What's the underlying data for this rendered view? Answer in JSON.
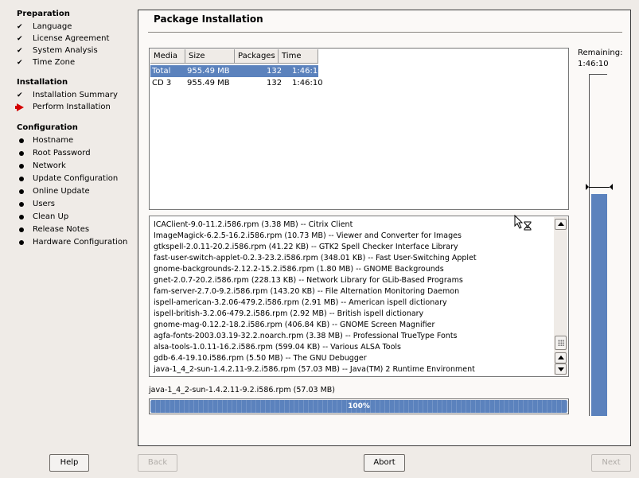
{
  "sidebar": {
    "sections": [
      {
        "title": "Preparation",
        "items": [
          {
            "label": "Language",
            "state": "done"
          },
          {
            "label": "License Agreement",
            "state": "done"
          },
          {
            "label": "System Analysis",
            "state": "done"
          },
          {
            "label": "Time Zone",
            "state": "done"
          }
        ]
      },
      {
        "title": "Installation",
        "items": [
          {
            "label": "Installation Summary",
            "state": "done"
          },
          {
            "label": "Perform Installation",
            "state": "current"
          }
        ]
      },
      {
        "title": "Configuration",
        "items": [
          {
            "label": "Hostname",
            "state": "pending"
          },
          {
            "label": "Root Password",
            "state": "pending"
          },
          {
            "label": "Network",
            "state": "pending"
          },
          {
            "label": "Update Configuration",
            "state": "pending"
          },
          {
            "label": "Online Update",
            "state": "pending"
          },
          {
            "label": "Users",
            "state": "pending"
          },
          {
            "label": "Clean Up",
            "state": "pending"
          },
          {
            "label": "Release Notes",
            "state": "pending"
          },
          {
            "label": "Hardware Configuration",
            "state": "pending"
          }
        ]
      }
    ]
  },
  "main": {
    "title": "Package Installation",
    "media_table": {
      "headers": [
        "Media",
        "Size",
        "Packages",
        "Time"
      ],
      "rows": [
        {
          "media": "Total",
          "size": "955.49 MB",
          "packages": "132",
          "time": "1:46:10",
          "selected": true
        },
        {
          "media": "CD 3",
          "size": "955.49 MB",
          "packages": "132",
          "time": "1:46:10",
          "selected": false
        }
      ]
    },
    "log_lines": [
      "ICAClient-9.0-11.2.i586.rpm (3.38 MB) -- Citrix Client",
      "ImageMagick-6.2.5-16.2.i586.rpm (10.73 MB) -- Viewer and Converter for Images",
      "gtkspell-2.0.11-20.2.i586.rpm (41.22 KB) -- GTK2 Spell Checker Interface Library",
      "fast-user-switch-applet-0.2.3-23.2.i586.rpm (348.01 KB) -- Fast User-Switching Applet",
      "gnome-backgrounds-2.12.2-15.2.i586.rpm (1.80 MB) -- GNOME Backgrounds",
      "gnet-2.0.7-20.2.i586.rpm (228.13 KB) -- Network Library for GLib-Based Programs",
      "fam-server-2.7.0-9.2.i586.rpm (143.20 KB) -- File Alternation Monitoring Daemon",
      "ispell-american-3.2.06-479.2.i586.rpm (2.91 MB) -- American ispell dictionary",
      "ispell-british-3.2.06-479.2.i586.rpm (2.92 MB) -- British ispell dictionary",
      "gnome-mag-0.12.2-18.2.i586.rpm (406.84 KB) -- GNOME Screen Magnifier",
      "agfa-fonts-2003.03.19-32.2.noarch.rpm (3.38 MB) -- Professional TrueType Fonts",
      "alsa-tools-1.0.11-16.2.i586.rpm (599.04 KB) -- Various ALSA Tools",
      "gdb-6.4-19.10.i586.rpm (5.50 MB) -- The GNU Debugger",
      "java-1_4_2-sun-1.4.2.11-9.2.i586.rpm (57.03 MB) -- Java(TM) 2 Runtime Environment"
    ],
    "current_package": "java-1_4_2-sun-1.4.2.11-9.2.i586.rpm (57.03 MB)",
    "progress": {
      "percent": 100,
      "label": "100%"
    },
    "remaining": {
      "label": "Remaining:",
      "time": "1:46:10",
      "fill_fraction": 0.65
    }
  },
  "buttons": {
    "help": "Help",
    "back": "Back",
    "abort": "Abort",
    "next": "Next"
  },
  "icons": {
    "done": "checkmark-icon",
    "current": "red-arrow-icon",
    "pending": "bullet-icon",
    "cursor": "busy-cursor-icon"
  },
  "colors": {
    "accent": "#5b82bd",
    "current_arrow": "#d40000",
    "background": "#efebe7"
  }
}
